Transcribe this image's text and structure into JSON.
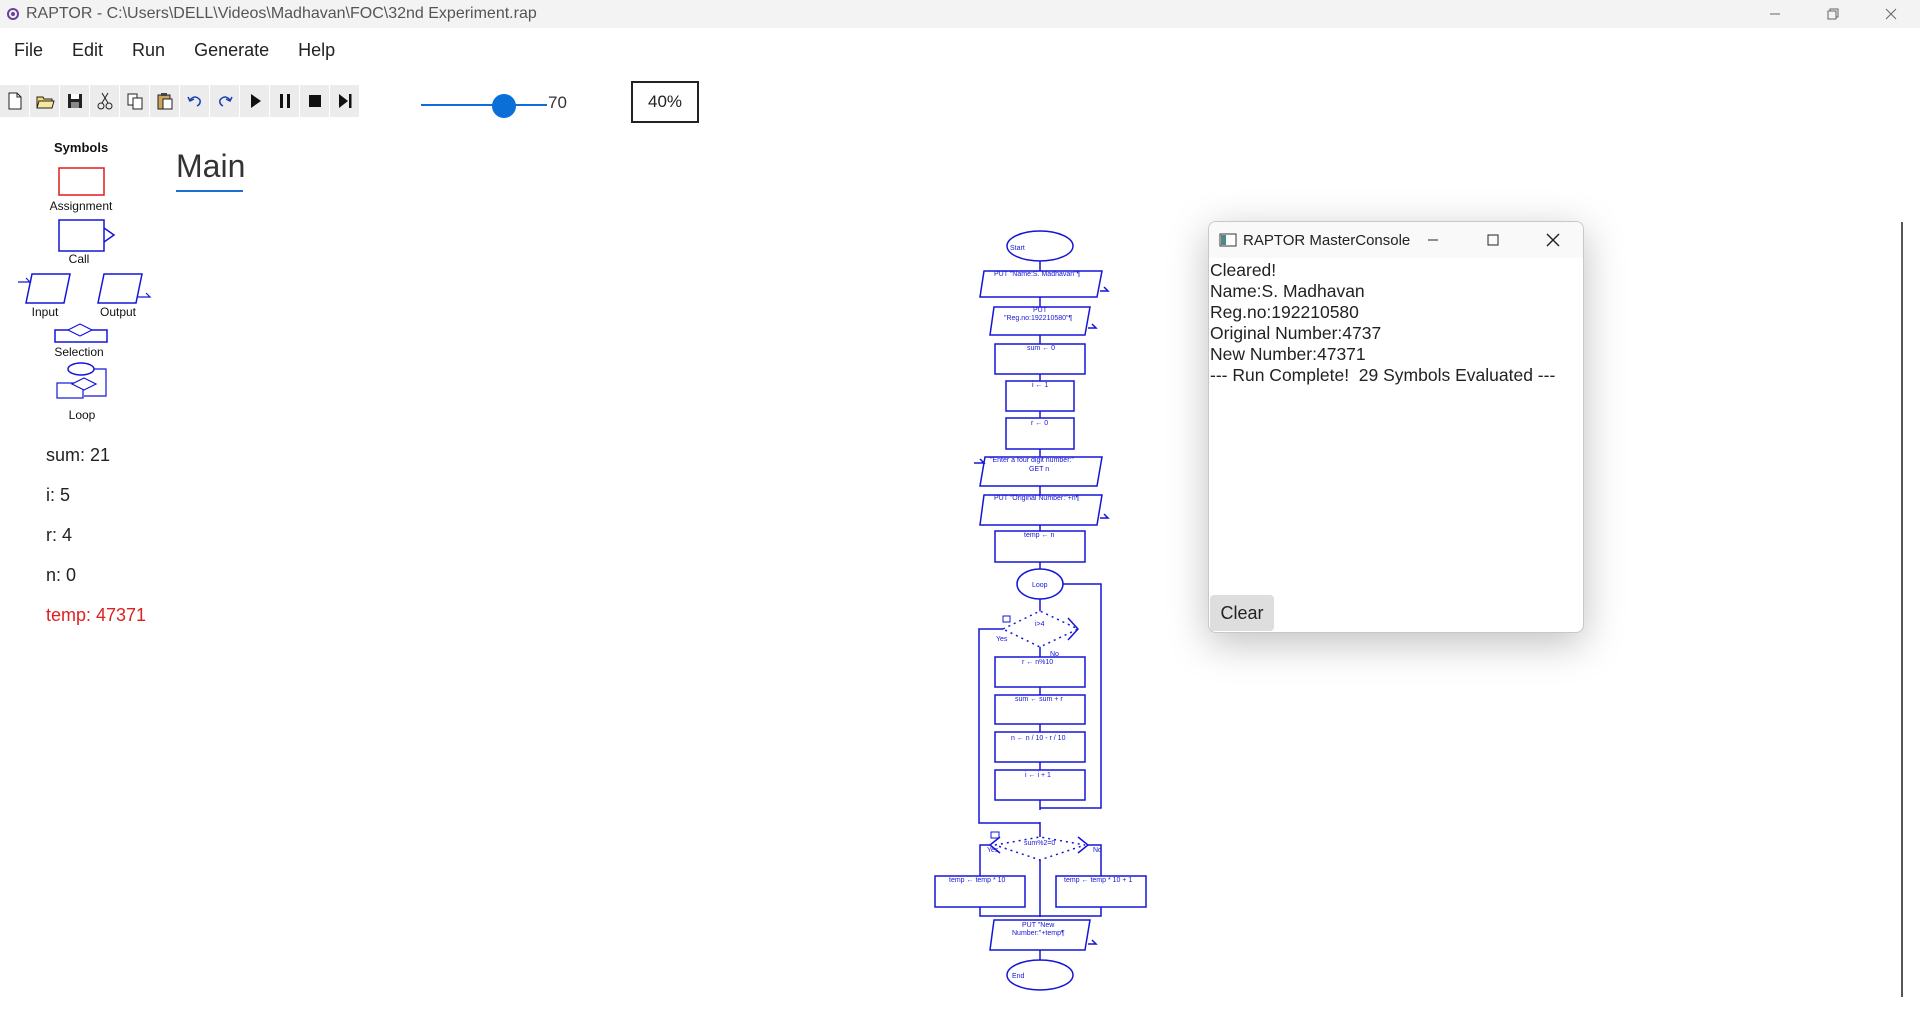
{
  "window": {
    "title": "RAPTOR - C:\\Users\\DELL\\Videos\\Madhavan\\FOC\\32nd Experiment.rap",
    "controls": [
      "minimize-icon",
      "restore-icon",
      "close-icon"
    ]
  },
  "menu": [
    "File",
    "Edit",
    "Run",
    "Generate",
    "Help"
  ],
  "toolbar": {
    "buttons": [
      "new-icon",
      "open-icon",
      "save-icon",
      "cut-icon",
      "copy-icon",
      "paste-icon",
      "undo-icon",
      "redo-icon",
      "play-icon",
      "pause-icon",
      "stop-icon",
      "step-icon"
    ],
    "speed_value": "70",
    "speed_fraction": 0.7,
    "zoom": "40%"
  },
  "symbols": {
    "title": "Symbols",
    "assignment": "Assignment",
    "call": "Call",
    "input": "Input",
    "output": "Output",
    "selection": "Selection",
    "loop": "Loop"
  },
  "variables": {
    "sum": "sum: 21",
    "i": "i: 5",
    "r": "r: 4",
    "n": "n: 0",
    "temp": "temp: 47371",
    "highlight_color": "#e02020"
  },
  "tab": {
    "label": "Main"
  },
  "flowchart": {
    "start": "Start",
    "put_name": "PUT \"Name:S. Madhavan\"¶",
    "put_reg_1": "PUT",
    "put_reg_2": "\"Reg.no:192210580\"¶",
    "sum_assign": "sum ← 0",
    "i_assign": "i ← 1",
    "r_assign": "r ← 0",
    "input_1": "\"Enter a four digit number:\"",
    "input_2": "GET n",
    "put_original": "PUT \"Original Number:\"+n¶",
    "temp_assign": "temp ← n",
    "loop": "Loop",
    "loop_cond": "i>4",
    "yes": "Yes",
    "no": "No",
    "r_calc": "r ← n%10",
    "sum_calc": "sum ← sum + r",
    "n_calc": "n ← n / 10 - r / 10",
    "i_inc": "i ← i + 1",
    "sel_cond": "sum%2=0",
    "temp_yes": "temp ← temp * 10",
    "temp_no": "temp ← temp * 10 + 1",
    "put_new_1": "PUT \"New",
    "put_new_2": "Number:\"+temp¶",
    "end": "End",
    "color": "#1515d8"
  },
  "console": {
    "title": "RAPTOR MasterConsole",
    "lines": [
      "Cleared!",
      "Name:S. Madhavan",
      "Reg.no:192210580",
      "Original Number:4737",
      "New Number:47371",
      "--- Run Complete!  29 Symbols Evaluated ---"
    ],
    "clear_label": "Clear"
  }
}
